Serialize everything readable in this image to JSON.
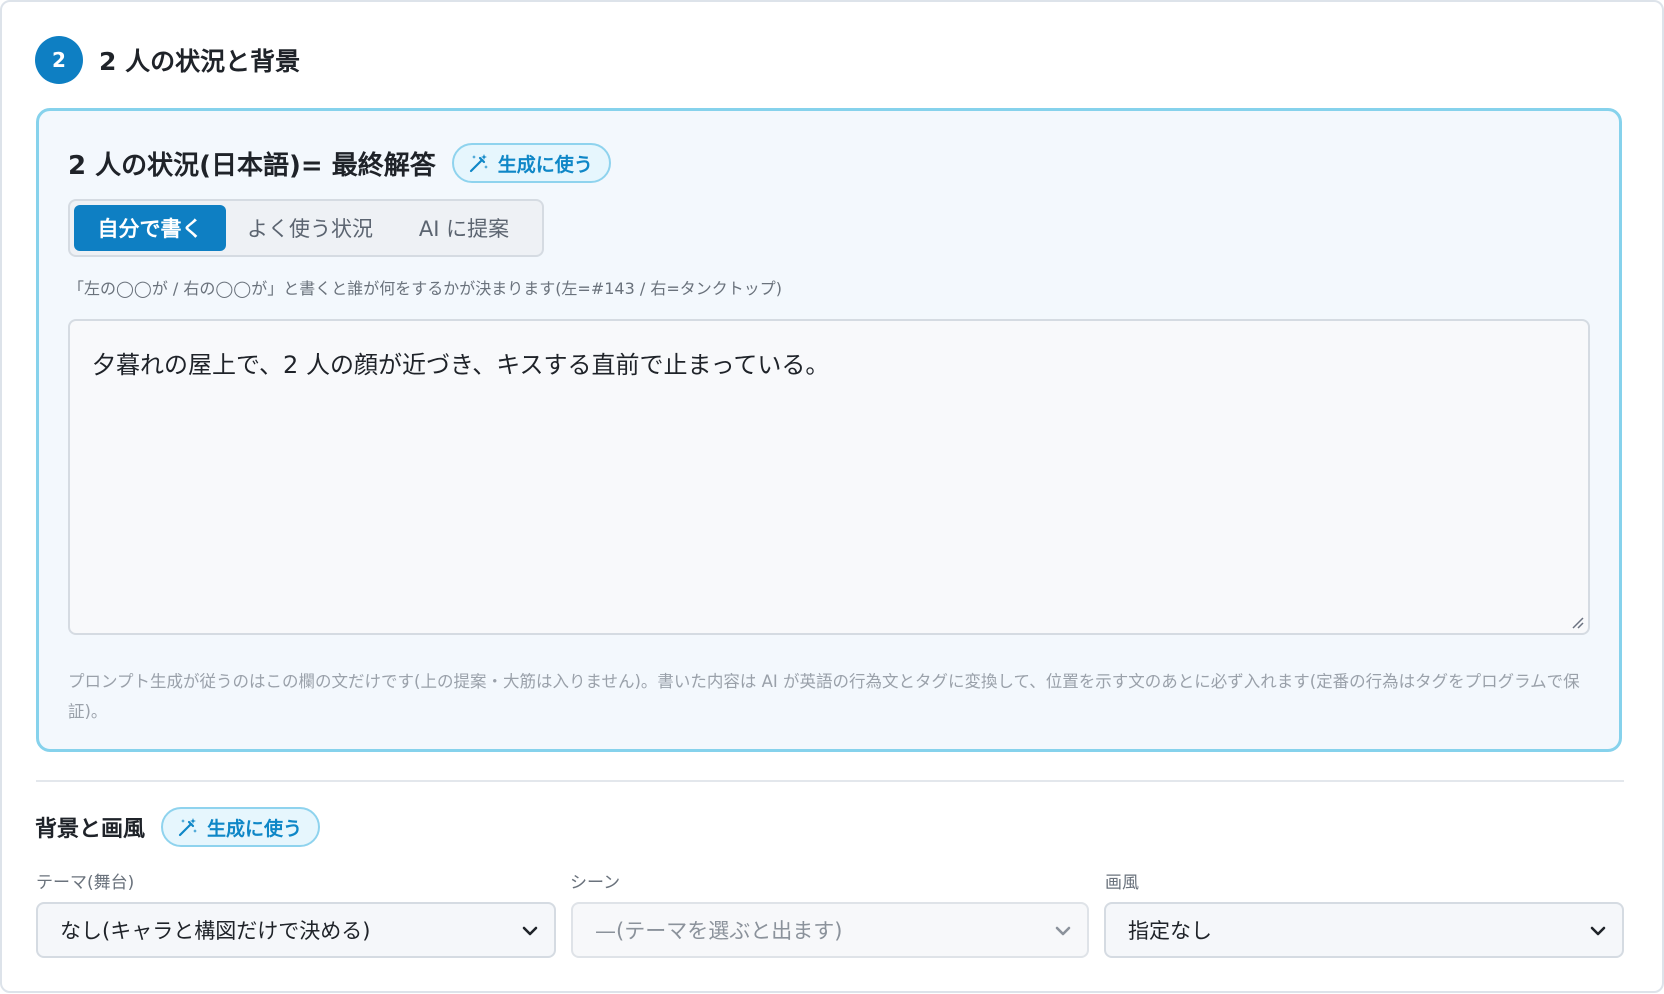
{
  "section": {
    "step_number": "2",
    "title": "2 人の状況と背景"
  },
  "situation": {
    "title": "2 人の状況(日本語)= 最終解答",
    "gen_chip_label": "生成に使う",
    "tabs": [
      {
        "label": "自分で書く",
        "active": true
      },
      {
        "label": "よく使う状況",
        "active": false
      },
      {
        "label": "AI に提案",
        "active": false
      }
    ],
    "hint": "「左の◯◯が / 右の◯◯が」と書くと誰が何をするかが決まります(左=#143 / 右=タンクトップ)",
    "text_value": "夕暮れの屋上で、2 人の顔が近づき、キスする直前で止まっている。",
    "note": "プロンプト生成が従うのはこの欄の文だけです(上の提案・大筋は入りません)。書いた内容は AI が英語の行為文とタグに変換して、位置を示す文のあとに必ず入れます(定番の行為はタグをプログラムで保証)。"
  },
  "background": {
    "title": "背景と画風",
    "gen_chip_label": "生成に使う",
    "fields": [
      {
        "label": "テーマ(舞台)",
        "value": "なし(キャラと構図だけで決める)",
        "disabled": false
      },
      {
        "label": "シーン",
        "value": "—(テーマを選ぶと出ます)",
        "disabled": true
      },
      {
        "label": "画風",
        "value": "指定なし",
        "disabled": false
      }
    ]
  },
  "colors": {
    "accent": "#0e7fc3",
    "panel_border": "#86d2ec",
    "panel_bg": "#f3f8fd",
    "chip_text": "#0f87c7"
  }
}
